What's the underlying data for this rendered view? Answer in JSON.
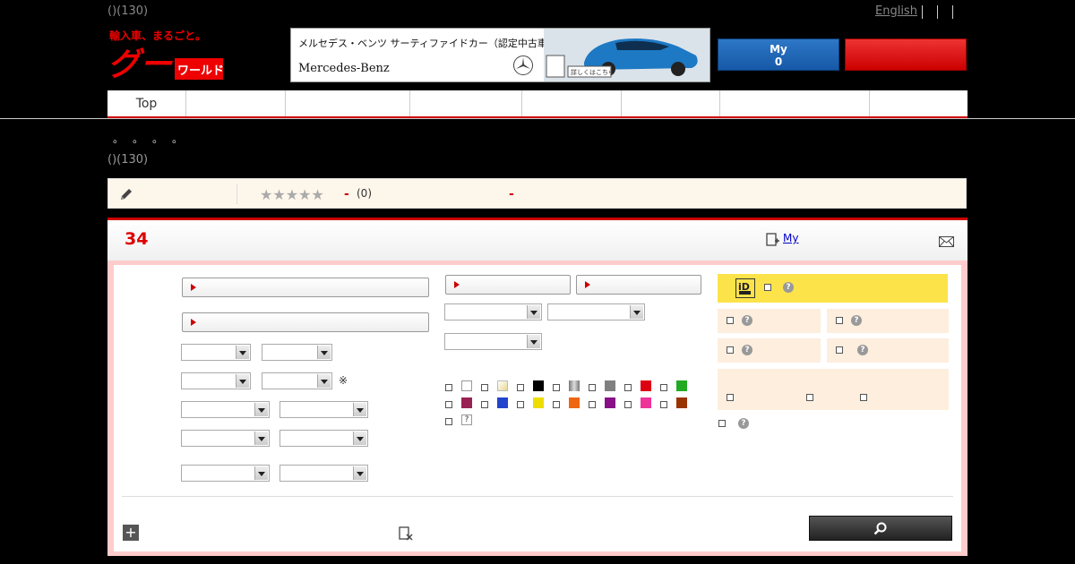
{
  "header": {
    "count_text": "()(130)",
    "lang_link": "English",
    "logo_alt": "グーワールド",
    "banner": {
      "headline": "メルセデス・ベンツ サーティファイドカー（認定中古車）",
      "brand": "Mercedes-Benz",
      "link_label": "詳しくはこちら"
    },
    "my_button": {
      "label": "My",
      "count": "0"
    }
  },
  "nav": {
    "items": [
      {
        "label": "Top"
      },
      {
        "label": ""
      },
      {
        "label": ""
      },
      {
        "label": ""
      },
      {
        "label": ""
      },
      {
        "label": ""
      },
      {
        "label": ""
      },
      {
        "label": ""
      }
    ]
  },
  "breadcrumb_dots": "。。。。",
  "sub_count": "()(130)",
  "review": {
    "stars": "★★★★★",
    "dash1": "-",
    "count": "(0)",
    "dash2": "-"
  },
  "results": {
    "count": "34",
    "my_link": "My"
  },
  "form": {
    "note_mark": "※",
    "help_glyph": "?",
    "colors": [
      "#ffffff",
      "#f5f0c8",
      "#000000",
      "#a0a0a0",
      "#808080",
      "#dd0011",
      "#22aa22",
      "#992255",
      "#2244cc",
      "#eedd00",
      "#ee6611",
      "#881188",
      "#ee3399",
      "#993300"
    ],
    "color_unknown": "?"
  },
  "icons": {
    "pencil": "pencil-icon",
    "mail": "mail-icon",
    "add_my": "add-favorite-icon",
    "plus": "plus-icon",
    "clear": "clear-icon",
    "search": "search-icon",
    "id_badge": "id-badge-icon"
  }
}
